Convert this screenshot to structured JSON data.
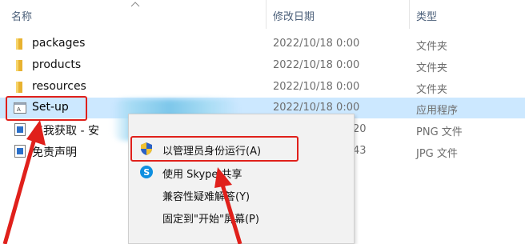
{
  "columns": {
    "name": "名称",
    "modified": "修改日期",
    "type": "类型"
  },
  "files": [
    {
      "name": "packages",
      "date": "2022/10/18 0:00",
      "type": "文件夹",
      "icon": "folder-icon"
    },
    {
      "name": "products",
      "date": "2022/10/18 0:00",
      "type": "文件夹",
      "icon": "folder-icon"
    },
    {
      "name": "resources",
      "date": "2022/10/18 0:00",
      "type": "文件夹",
      "icon": "folder-icon"
    },
    {
      "name": "Set-up",
      "date": "2022/10/18 0:00",
      "type": "应用程序",
      "icon": "setup-app-icon",
      "selected": true
    },
    {
      "name": "点我获取 - 安",
      "date": "20",
      "type": "PNG 文件",
      "icon": "png-file-icon"
    },
    {
      "name": "免责声明",
      "date": "43",
      "type": "JPG 文件",
      "icon": "jpg-file-icon"
    }
  ],
  "context_menu": {
    "items": [
      {
        "label": "以管理员身份运行(A)",
        "icon": "uac-shield-icon"
      },
      {
        "label": "使用 Skype 共享",
        "icon": "skype-icon"
      },
      {
        "label": "兼容性疑难解答(Y)",
        "icon": ""
      },
      {
        "label": "固定到\"开始\"屏幕(P)",
        "icon": ""
      }
    ]
  },
  "colors": {
    "selection": "#cce8ff",
    "highlight_border": "#e0201b",
    "header_text": "#4c607a",
    "folder": "#e8b230"
  }
}
